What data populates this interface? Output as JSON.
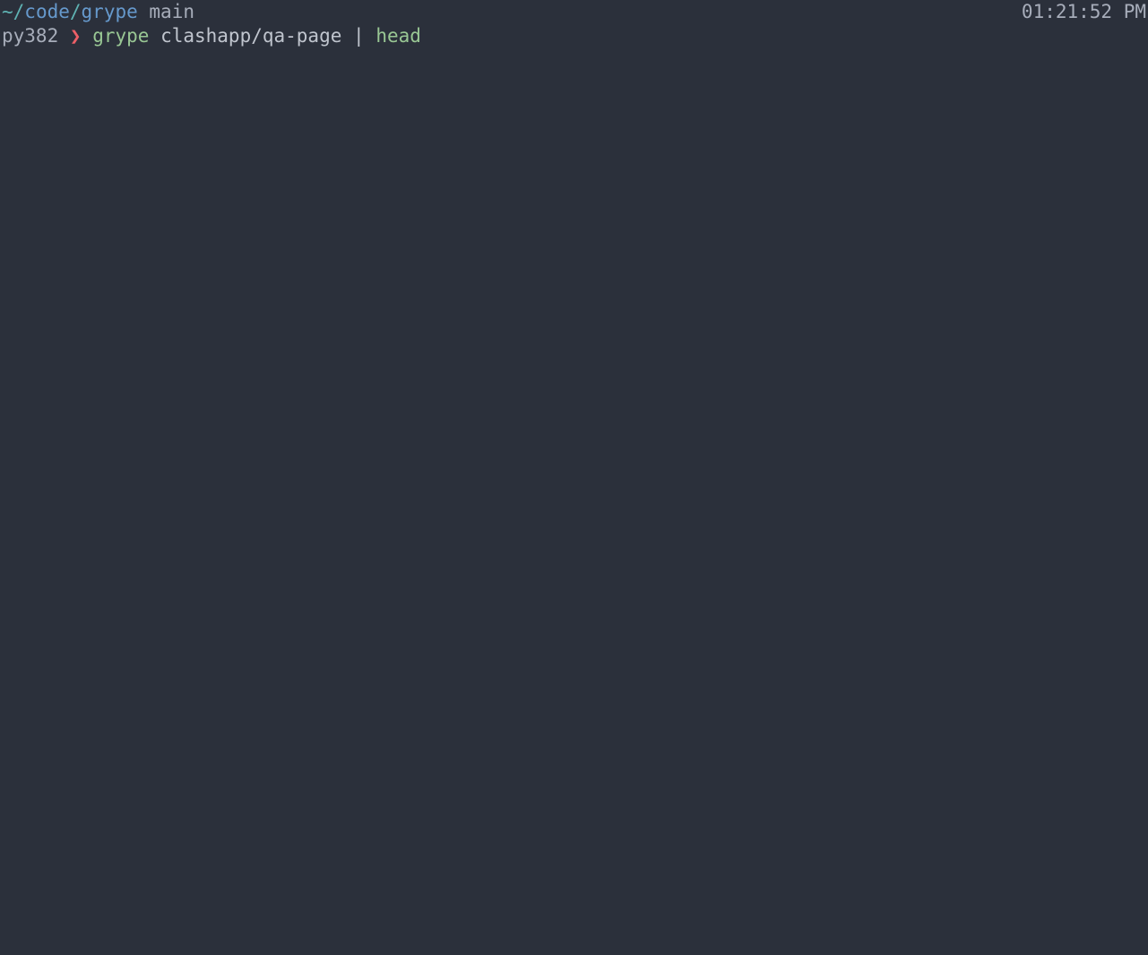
{
  "prompt": {
    "path_prefix": "~/",
    "path_seg1": "code",
    "path_sep": "/",
    "path_seg2": "grype",
    "branch": "main",
    "time": "01:21:52 PM",
    "env": "py382",
    "chevron": "❯"
  },
  "command": {
    "name": "grype",
    "arg": "clashapp/qa-page",
    "pipe": "|",
    "tail": "head"
  }
}
